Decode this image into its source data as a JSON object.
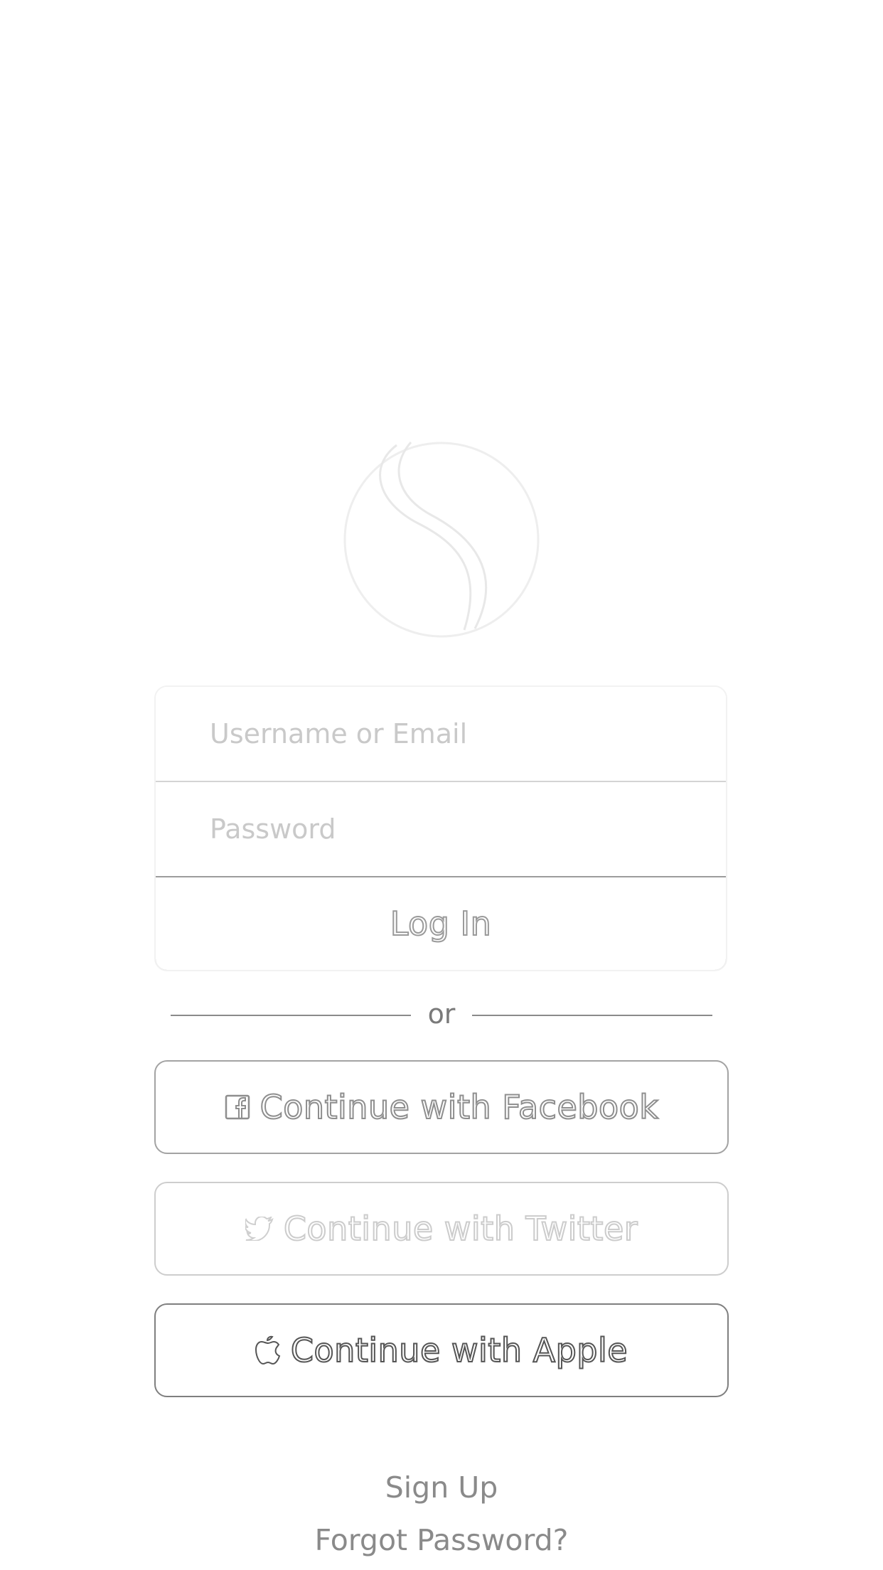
{
  "login_form": {
    "username_placeholder": "Username or Email",
    "password_placeholder": "Password",
    "login_label": "Log In"
  },
  "divider": {
    "label": "or"
  },
  "social": {
    "facebook_label": "Continue with Facebook",
    "twitter_label": "Continue with Twitter",
    "apple_label": "Continue with Apple"
  },
  "links": {
    "signup_label": "Sign Up",
    "forgot_label": "Forgot Password?"
  },
  "icons": {
    "logo": "app-logo-icon",
    "facebook": "facebook-icon",
    "twitter": "twitter-icon",
    "apple": "apple-icon"
  },
  "colors": {
    "background": "#ffffff",
    "border": "#9c9c9c",
    "muted_text": "#8a8a8a"
  }
}
